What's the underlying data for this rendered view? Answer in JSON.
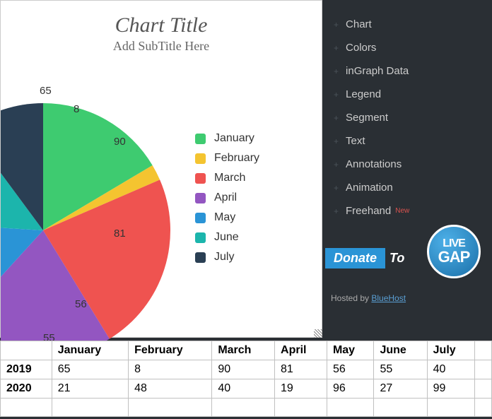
{
  "chart_data": {
    "type": "pie",
    "title": "Chart Title",
    "subtitle": "Add SubTitle Here",
    "categories": [
      "January",
      "February",
      "March",
      "April",
      "May",
      "June",
      "July"
    ],
    "series": [
      {
        "name": "2019",
        "values": [
          65,
          8,
          90,
          81,
          56,
          55,
          40
        ]
      },
      {
        "name": "2020",
        "values": [
          21,
          48,
          40,
          19,
          96,
          27,
          99
        ]
      }
    ],
    "colors": [
      "#3ecb70",
      "#f4c430",
      "#ef5350",
      "#9356c1",
      "#2a94d6",
      "#1cb5ac",
      "#2a3f54"
    ],
    "legend": {
      "position": "right"
    }
  },
  "sidebar": {
    "items": [
      {
        "label": "Chart"
      },
      {
        "label": "Colors"
      },
      {
        "label": "inGraph Data"
      },
      {
        "label": "Legend"
      },
      {
        "label": "Segment"
      },
      {
        "label": "Text"
      },
      {
        "label": "Annotations"
      },
      {
        "label": "Animation"
      },
      {
        "label": "Freehand",
        "badge": "New"
      }
    ]
  },
  "donate": {
    "button": "Donate",
    "to": "To",
    "logo": "LIVE GAP"
  },
  "hosted": {
    "prefix": "Hosted by ",
    "link": "BlueHost"
  },
  "table": {
    "cols": [
      "January",
      "February",
      "March",
      "April",
      "May",
      "June",
      "July"
    ],
    "rows": [
      {
        "year": "2019",
        "cells": [
          "65",
          "8",
          "90",
          "81",
          "56",
          "55",
          "40"
        ]
      },
      {
        "year": "2020",
        "cells": [
          "21",
          "48",
          "40",
          "19",
          "96",
          "27",
          "99"
        ]
      }
    ]
  }
}
